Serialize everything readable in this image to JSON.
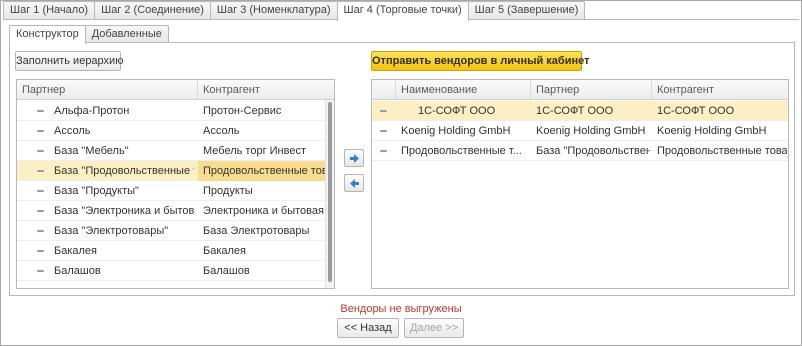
{
  "top_tabs": [
    {
      "label": "Шаг 1 (Начало)",
      "active": false
    },
    {
      "label": "Шаг 2 (Соединение)",
      "active": false
    },
    {
      "label": "Шаг 3 (Номенклатура)",
      "active": false
    },
    {
      "label": "Шаг 4 (Торговые точки)",
      "active": true
    },
    {
      "label": "Шаг 5 (Завершение)",
      "active": false
    }
  ],
  "inner_tabs": [
    {
      "label": "Конструктор",
      "active": true
    },
    {
      "label": "Добавленные",
      "active": false
    }
  ],
  "fill_hierarchy_label": "Заполнить иерархию",
  "send_vendors_label": "Отправить вендоров в личный кабинет",
  "left_grid": {
    "columns": [
      "Партнер",
      "Контрагент"
    ],
    "rows": [
      {
        "partner": "Альфа-Протон",
        "counterparty": "Протон-Сервис",
        "selected": false
      },
      {
        "partner": "Ассоль",
        "counterparty": "Ассоль",
        "selected": false
      },
      {
        "partner": "База \"Мебель\"",
        "counterparty": "Мебель торг Инвест",
        "selected": false
      },
      {
        "partner": "База \"Продовольственные то...",
        "counterparty": "Продовольственные това...",
        "selected": true
      },
      {
        "partner": "База \"Продукты\"",
        "counterparty": "Продукты",
        "selected": false
      },
      {
        "partner": "База \"Электроника и бытова...",
        "counterparty": "Электроника и бытовая т...",
        "selected": false
      },
      {
        "partner": "База \"Электротовары\"",
        "counterparty": "База Электротовары",
        "selected": false
      },
      {
        "partner": "Бакалея",
        "counterparty": "Бакалея",
        "selected": false
      },
      {
        "partner": "Балашов",
        "counterparty": "Балашов",
        "selected": false
      }
    ]
  },
  "right_grid": {
    "columns": [
      "Наименование",
      "Партнер",
      "Контрагент"
    ],
    "rows": [
      {
        "name": "1С-СОФТ ООО",
        "partner": "1С-СОФТ ООО",
        "counterparty": "1С-СОФТ ООО",
        "selected": true
      },
      {
        "name": "Koenig Holding GmbH",
        "partner": "Koenig Holding GmbH",
        "counterparty": "Koenig Holding GmbH",
        "selected": false
      },
      {
        "name": "Продовольственные т...",
        "partner": "База \"Продовольствен...",
        "counterparty": "Продовольственные товары",
        "selected": false
      }
    ]
  },
  "move_right_icon": "arrow-right-icon",
  "move_left_icon": "arrow-left-icon",
  "status_text": "Вендоры не выгружены",
  "back_label": "<< Назад",
  "next_label": "Далее >>",
  "colors": {
    "accent_yellow": "#f1c40f",
    "selection_row": "#fcefc4",
    "selection_cell": "#f9dd8e",
    "status_red": "#c0392b",
    "arrow_blue": "#2f7fd6"
  }
}
